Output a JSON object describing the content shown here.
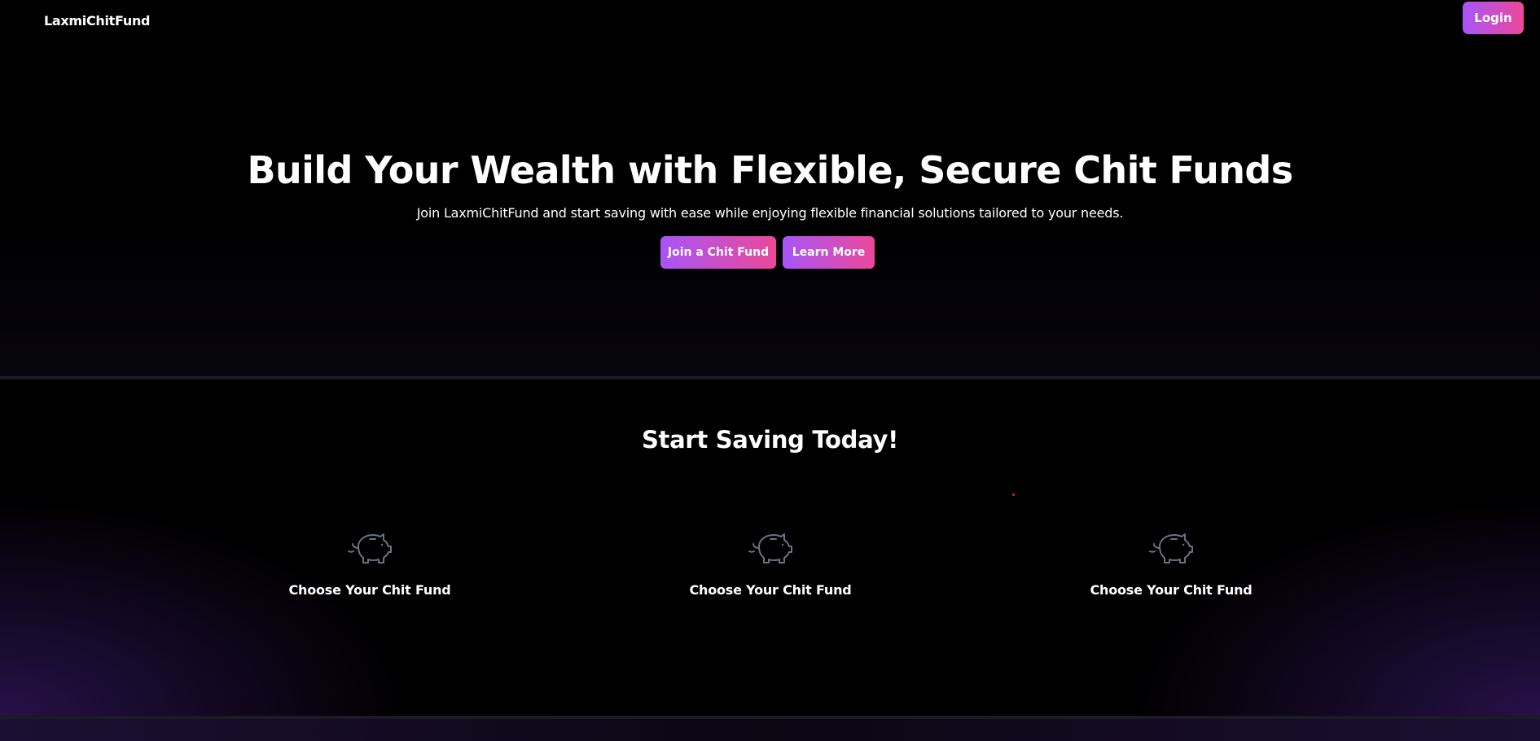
{
  "nav": {
    "brand": "LaxmiChitFund",
    "login_label": "Login"
  },
  "hero": {
    "title": "Build Your Wealth with Flexible, Secure Chit Funds",
    "subtitle": "Join LaxmiChitFund and start saving with ease while enjoying flexible financial solutions tailored to your needs.",
    "primary_cta": "Join a Chit Fund",
    "secondary_cta": "Learn More"
  },
  "steps": {
    "title": "Start Saving Today!",
    "items": [
      {
        "icon": "piggy-bank-icon",
        "label": "Choose Your Chit Fund"
      },
      {
        "icon": "piggy-bank-icon",
        "label": "Choose Your Chit Fund"
      },
      {
        "icon": "piggy-bank-icon",
        "label": "Choose Your Chit Fund"
      }
    ]
  },
  "colors": {
    "background": "#000000",
    "button_gradient_start": "#a855f7",
    "button_gradient_end": "#ec4899",
    "icon_stroke": "#6b7280",
    "glow": "#46207f"
  }
}
